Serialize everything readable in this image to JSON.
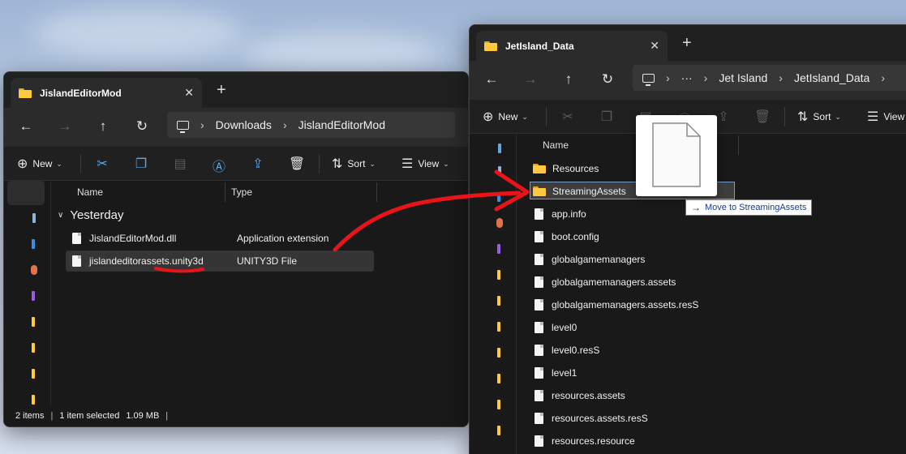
{
  "window1": {
    "tab_title": "JislandEditorMod",
    "new_tab": "+",
    "close_tab": "✕",
    "breadcrumb": [
      "Downloads",
      "JislandEditorMod"
    ],
    "commands": {
      "new_label": "New",
      "sort_label": "Sort",
      "view_label": "View"
    },
    "columns": {
      "name": "Name",
      "type": "Type"
    },
    "group_label": "Yesterday",
    "files": [
      {
        "name": "JislandEditorMod.dll",
        "type": "Application extension"
      },
      {
        "name": "jislandeditorassets.unity3d",
        "type": "UNITY3D File"
      }
    ],
    "status": {
      "items": "2 items",
      "selected": "1 item selected",
      "size": "1.09 MB"
    }
  },
  "window2": {
    "tab_title": "JetIsland_Data",
    "new_tab": "+",
    "close_tab": "✕",
    "breadcrumb_ellipsis": "···",
    "breadcrumb": [
      "Jet Island",
      "JetIsland_Data"
    ],
    "commands": {
      "new_label": "New",
      "sort_label": "Sort",
      "view_label": "View"
    },
    "columns": {
      "name": "Name"
    },
    "folders": [
      "Resources",
      "StreamingAssets"
    ],
    "files": [
      "app.info",
      "boot.config",
      "globalgamemanagers",
      "globalgamemanagers.assets",
      "globalgamemanagers.assets.resS",
      "level0",
      "level0.resS",
      "level1",
      "resources.assets",
      "resources.assets.resS",
      "resources.resource"
    ]
  },
  "drag": {
    "tooltip": "Move to StreamingAssets"
  },
  "colors": {
    "folder": "#ffc83d",
    "annotation": "#e8141a",
    "accent": "#5fa8e8"
  }
}
